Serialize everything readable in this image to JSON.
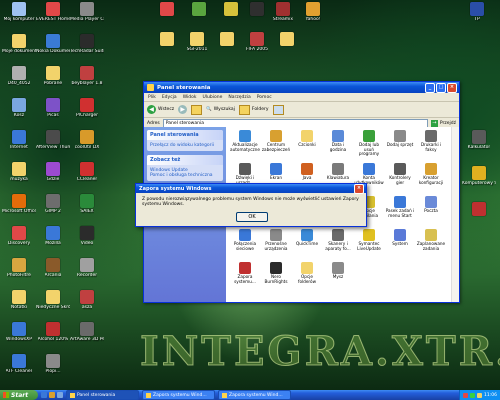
{
  "desktop": {
    "watermark": "INTEGRA.XTR.PL",
    "icons_left": [
      {
        "label": "Mój komputer",
        "color": "#9ec2f0"
      },
      {
        "label": "EVEREST Home Edition",
        "color": "#e04848"
      },
      {
        "label": "Media Player Classic",
        "color": "#8a8a8a"
      },
      {
        "label": "Moje dokumenty",
        "color": "#f2d36b"
      },
      {
        "label": "Nokia Dokumenty",
        "color": "#3a7bd5"
      },
      {
        "label": "TechRadar Suite",
        "color": "#2b2b2b"
      },
      {
        "label": "D40_4052",
        "color": "#b0b0b0"
      },
      {
        "label": "Pobrane",
        "color": "#f2d36b"
      },
      {
        "label": "beyblayer 1.8",
        "color": "#c04040"
      },
      {
        "label": "Kosz",
        "color": "#7aa7e0"
      },
      {
        "label": "Picas",
        "color": "#7d52c8"
      },
      {
        "label": "PICharger",
        "color": "#d03030"
      },
      {
        "label": "Internet",
        "color": "#3a78d8"
      },
      {
        "label": "AfterView Thumbnails",
        "color": "#4b4b4b"
      },
      {
        "label": "coolUtil DX",
        "color": "#d89a2a"
      },
      {
        "label": "muzyka",
        "color": "#f2d36b"
      },
      {
        "label": "Gdzie",
        "color": "#9c4bd0"
      },
      {
        "label": "CCleaner",
        "color": "#d03030"
      },
      {
        "label": "Microsoft Office",
        "color": "#e36c0a"
      },
      {
        "label": "GIMP 2",
        "color": "#6d6d6d"
      },
      {
        "label": "SAIEX",
        "color": "#2a8a3a"
      },
      {
        "label": "Discovery",
        "color": "#e04848"
      },
      {
        "label": "Mozilla",
        "color": "#3a78d8"
      },
      {
        "label": "Video",
        "color": "#2b2b2b"
      },
      {
        "label": "PhotoFiltre",
        "color": "#d9a640"
      },
      {
        "label": "Arcania",
        "color": "#8a5a2a"
      },
      {
        "label": "Recorder",
        "color": "#a0a0a0"
      },
      {
        "label": "Notatki",
        "color": "#f2d36b"
      },
      {
        "label": "Niedyczne Skróty",
        "color": "#f2d36b"
      },
      {
        "label": "asza",
        "color": "#c04040"
      },
      {
        "label": "WindowsXP",
        "color": "#3a78d8"
      },
      {
        "label": "Alcohol 120%",
        "color": "#c03030"
      },
      {
        "label": "ArtAware 3D Personal",
        "color": "#6a6a6a"
      },
      {
        "label": "ATF Cleaner",
        "color": "#3a78d8"
      },
      {
        "label": "Plopi...",
        "color": "#8a8a8a"
      }
    ],
    "icons_top": [
      {
        "label": "",
        "color": "#e04848"
      },
      {
        "label": "",
        "color": "#5aa53f"
      },
      {
        "label": "",
        "color": "#d6c23b"
      },
      {
        "label": "",
        "color": "#2f2f2f"
      },
      {
        "label": "Streamix",
        "color": "#a03030"
      },
      {
        "label": "Yahoo!",
        "color": "#e0a030"
      },
      {
        "label": "TP",
        "color": "#2a4ea8"
      }
    ],
    "icons_top_row2": [
      {
        "label": "",
        "color": "#f2d36b"
      },
      {
        "label": "SGI-2011",
        "color": "#f2d36b"
      },
      {
        "label": "",
        "color": "#f2d36b"
      },
      {
        "label": "FIFA 2005",
        "color": "#c04040"
      },
      {
        "label": "",
        "color": "#f2d36b"
      }
    ],
    "icons_right": [
      {
        "label": "Kalkulator",
        "color": "#5a5a5a"
      },
      {
        "label": "Komputerowy Słownik Niem.",
        "color": "#e0b020"
      },
      {
        "label": "",
        "color": "#c03030"
      }
    ]
  },
  "window": {
    "title": "Panel sterowania",
    "menu": [
      "Plik",
      "Edycja",
      "Widok",
      "Ulubione",
      "Narzędzia",
      "Pomoc"
    ],
    "toolbar": {
      "back": "Wstecz",
      "search": "Wyszukaj",
      "folders": "Foldery"
    },
    "address_label": "Adres",
    "address_value": "Panel sterowania",
    "go_label": "Przejdź",
    "left_panel": {
      "title": "Panel sterowania",
      "switch_link": "Przełącz do widoku kategorii",
      "see_also_title": "Zobacz też",
      "see_also_items": [
        "Windows Update",
        "Pomoc i obsługa techniczna"
      ]
    },
    "items": [
      {
        "label": "Aktualizacje automatyczne",
        "color": "#3a8ad8"
      },
      {
        "label": "Centrum zabezpieczeń",
        "color": "#d8a030"
      },
      {
        "label": "Czcionki",
        "color": "#f2d36b"
      },
      {
        "label": "Data i godzina",
        "color": "#5a8ad8"
      },
      {
        "label": "Dodaj lub usuń programy",
        "color": "#3aa03a"
      },
      {
        "label": "Dodaj sprzęt",
        "color": "#8a8a8a"
      },
      {
        "label": "Drukarki i faksy",
        "color": "#6a6a6a"
      },
      {
        "label": "Dźwięki i urządz...",
        "color": "#5a5a5a"
      },
      {
        "label": "Ekran",
        "color": "#3a78d8"
      },
      {
        "label": "Java",
        "color": "#d06020"
      },
      {
        "label": "Klawiatura",
        "color": "#7a7a7a"
      },
      {
        "label": "Konta użytkowników",
        "color": "#3a78d8"
      },
      {
        "label": "Kontrolery gier",
        "color": "#5a5a5a"
      },
      {
        "label": "Kreator konfiguracji",
        "color": "#d8a030"
      },
      {
        "label": "Opcje internetowe",
        "color": "#3a78d8"
      },
      {
        "label": "Opcje regional...",
        "color": "#3a9a3a"
      },
      {
        "label": "Opcje telefonu i modemu",
        "color": "#6a6a6a"
      },
      {
        "label": "Opcje ułatwień",
        "color": "#3a78d8"
      },
      {
        "label": "Opcje zasilania",
        "color": "#d8c030"
      },
      {
        "label": "Pasek zadań i menu Start",
        "color": "#3a78d8"
      },
      {
        "label": "Poczta",
        "color": "#6a8ad8"
      },
      {
        "label": "Połączenia sieciowe",
        "color": "#3a78d8"
      },
      {
        "label": "Przenośne urządzenia",
        "color": "#8a8a8a"
      },
      {
        "label": "QuickTime",
        "color": "#3a8ad8"
      },
      {
        "label": "Skanery i aparaty fo...",
        "color": "#6a6a6a"
      },
      {
        "label": "Symantec LiveUpdate",
        "color": "#e0c020"
      },
      {
        "label": "System",
        "color": "#5a7ad8"
      },
      {
        "label": "Zaplanowane zadania",
        "color": "#d8c050"
      },
      {
        "label": "Zapora systemu...",
        "color": "#c03030"
      },
      {
        "label": "Nero BurnRights",
        "color": "#2b2b2b"
      },
      {
        "label": "Opcje folderów",
        "color": "#f2d36b"
      },
      {
        "label": "Mysz",
        "color": "#8a8a8a"
      }
    ]
  },
  "dialog": {
    "title": "Zapora systemu Windows",
    "message": "Z powodu nierozwiązywalnego problemu system Windows nie może wyświetlić ustawień Zapory systemu Windows.",
    "ok_label": "OK"
  },
  "taskbar": {
    "start_label": "Start",
    "tasks": [
      {
        "label": "Panel sterowania",
        "active": true
      },
      {
        "label": "Zapora systemu Wind...",
        "active": false
      },
      {
        "label": "Zapora systemu Wind...",
        "active": false
      }
    ],
    "clock": "11:06"
  }
}
